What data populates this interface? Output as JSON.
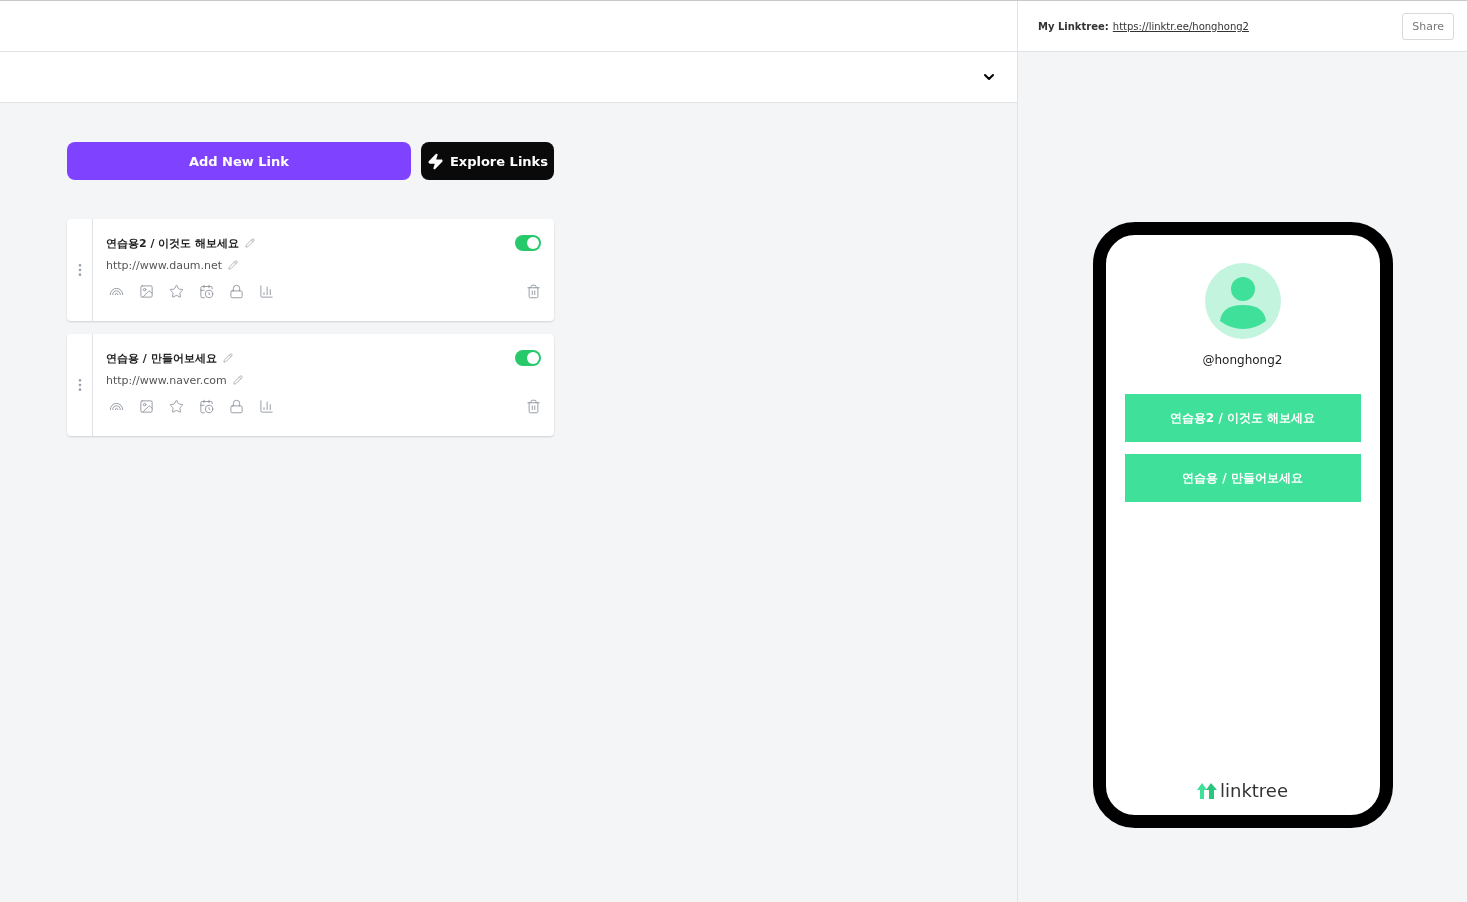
{
  "header": {
    "label": "My Linktree:",
    "url": "https://linktr.ee/honghong2",
    "share": "Share"
  },
  "actions": {
    "add": "Add New Link",
    "explore": "Explore Links"
  },
  "links": [
    {
      "title": "연습용2 / 이것도 해보세요",
      "url": "http://www.daum.net",
      "enabled": true
    },
    {
      "title": "연습용 / 만들어보세요",
      "url": "http://www.naver.com",
      "enabled": true
    }
  ],
  "preview": {
    "username": "@honghong2",
    "buttons": [
      "연습용2 / 이것도 해보세요",
      "연습용 / 만들어보세요"
    ],
    "brand": "linktree"
  }
}
